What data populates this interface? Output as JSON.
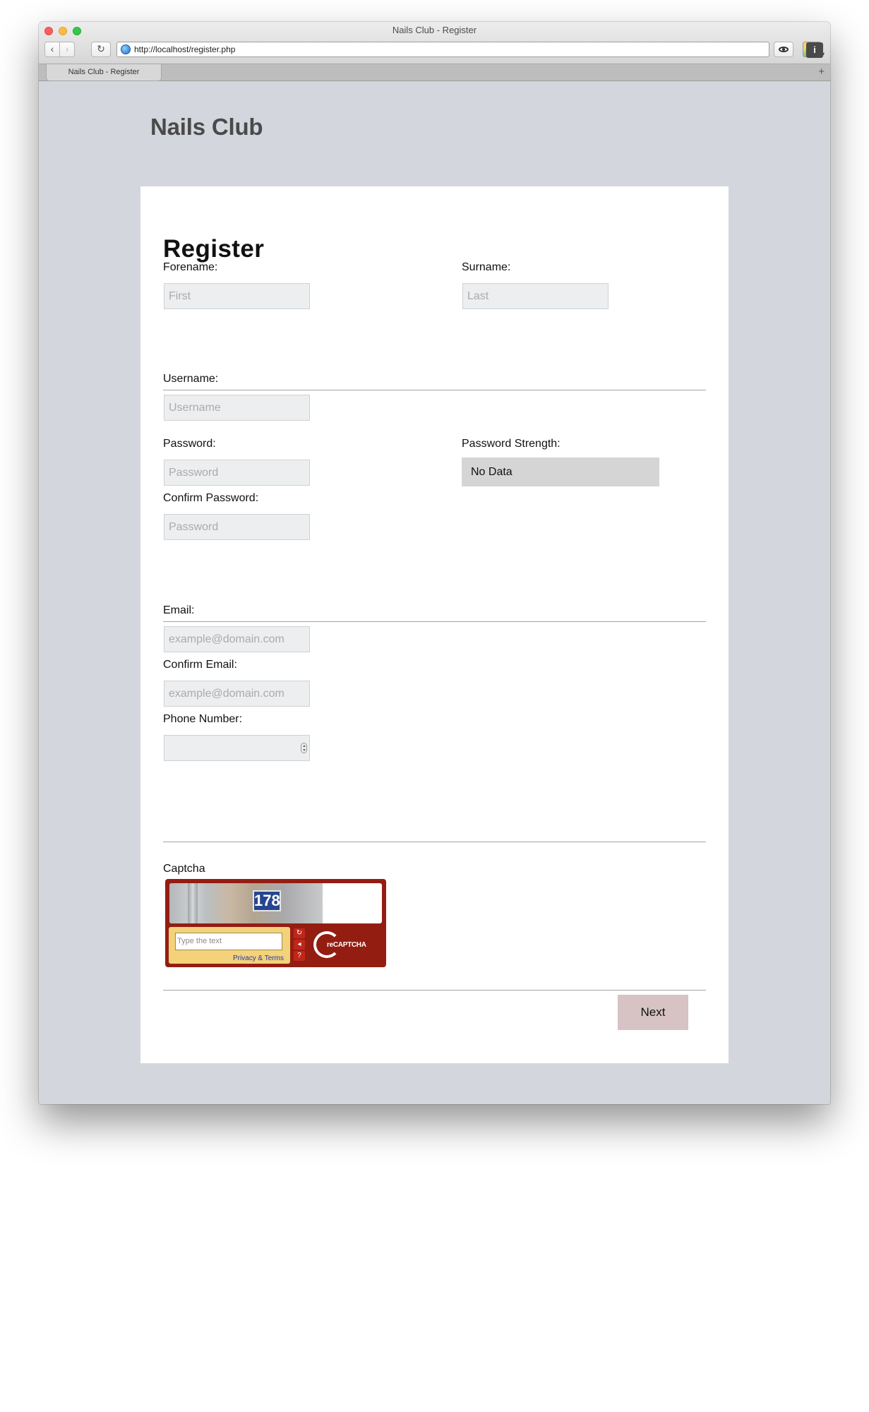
{
  "window": {
    "title": "Nails Club - Register",
    "url": "http://localhost/register.php",
    "tab_label": "Nails Club - Register",
    "nav_back_glyph": "‹",
    "nav_forward_glyph": "›",
    "reload_glyph": "↻",
    "info_glyph": "i",
    "new_tab_glyph": "+"
  },
  "site": {
    "title": "Nails Club"
  },
  "form": {
    "heading": "Register",
    "forename": {
      "label": "Forename:",
      "placeholder": "First"
    },
    "surname": {
      "label": "Surname:",
      "placeholder": "Last"
    },
    "username": {
      "label": "Username:",
      "placeholder": "Username"
    },
    "password": {
      "label": "Password:",
      "placeholder": "Password"
    },
    "password_strength": {
      "label": "Password Strength:",
      "value": "No Data"
    },
    "confirm_password": {
      "label": "Confirm Password:",
      "placeholder": "Password"
    },
    "email": {
      "label": "Email:",
      "placeholder": "example@domain.com"
    },
    "confirm_email": {
      "label": "Confirm Email:",
      "placeholder": "example@domain.com"
    },
    "phone": {
      "label": "Phone Number:",
      "value": ""
    },
    "captcha": {
      "label": "Captcha",
      "image_text": "178",
      "input_placeholder": "Type the text",
      "terms_link": "Privacy & Terms",
      "logo_text": "reCAPTCHA"
    },
    "next_button": "Next"
  },
  "colors": {
    "page_background": "#d4d6dd",
    "field_background": "#eceeef",
    "next_button": "#d7c3c4",
    "captcha_frame": "#941d12"
  }
}
